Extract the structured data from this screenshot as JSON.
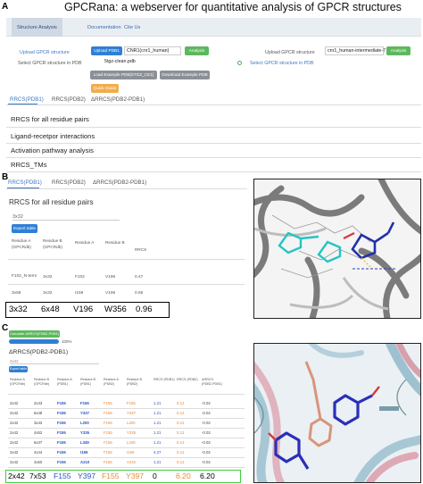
{
  "figure": {
    "title": "GPCRana: a webserver for quantitative analysis of GPCR structures",
    "panel_letters": [
      "A",
      "B",
      "C"
    ]
  },
  "panel_a": {
    "nav": [
      "Structure Analysis",
      "Documentation",
      "Cite Us"
    ],
    "upload_gpcr_label_left": "Upload GPCR structure",
    "select_pdb_label": "Select GPCR structure in PDB",
    "upload_pdb1_button": "Upload PDB1",
    "pdb1_value": "CNR1(cnr1_human)",
    "analysis_button": "Analysis",
    "pdb_file_value": "5tgz-clean.pdb",
    "load_example_pdb": "Load Example PDB(5TGZ_CE1)",
    "download_example_pdb": "Download Example PDB",
    "quick_guide_button": "Quick Guide",
    "upload_gpcr_label_right": "Upload GPCR structure",
    "right_select_value": "cnr1_human-intermediate-7",
    "select_pdb_right": "Select GPCR structure in PDB",
    "tabs": [
      "RRCS(PDB1)",
      "RRCS(PDB2)",
      "ΔRRCS(PDB2-PDB1)"
    ],
    "sections": [
      "RRCS for all residue pairs",
      "Ligand-recetpor interactions",
      "Activation pathway analysis",
      "RRCS_TMs"
    ],
    "colors": {
      "accent": "#2f7fd6",
      "green": "#5cb85c",
      "orange": "#f0ad4e",
      "link": "#3d79c1"
    }
  },
  "panel_b": {
    "tabs": [
      "RRCS(PDB1)",
      "RRCS(PDB2)",
      "ΔRRCS(PDB2-PDB1)"
    ],
    "title": "RRCS for all residue pairs",
    "input_value": "3x32",
    "export_button": "Export table",
    "headers": [
      "Residue A (GPCRdb)",
      "Residue B (GPCRdb)",
      "Residue A",
      "Residue B",
      "RRCS"
    ],
    "rows": [
      [
        "F102_N-term",
        "3x32",
        "F102",
        "V196",
        "0.47"
      ],
      [
        "3x56",
        "3x32",
        "I159",
        "V196",
        "0.55"
      ]
    ],
    "highlight_row": [
      "3x32",
      "6x48",
      "V196",
      "W356",
      "0.96"
    ]
  },
  "panel_c": {
    "calc_button": "Calculate ΔRRCS(PDB2-PDB1)",
    "progress_label": "100%",
    "progress_fraction": 1.0,
    "title": "ΔRRCS(PDB2-PDB1)",
    "input_value": "2x42",
    "export_button": "Export table",
    "headers": [
      "Residue A (GPCRdb)",
      "Residue B (GPCRdb)",
      "Residue A (PDB1)",
      "Residue B (PDB1)",
      "Residue A (PDB2)",
      "Residue B (PDB2)",
      "RRCS (PDB1)",
      "RRCS (PDB2)",
      "ΔRRCS (PDB2-PDB1)"
    ],
    "rows": [
      [
        "2x42",
        "2x43",
        "F155",
        "F155",
        "F155",
        "F155",
        "1.21",
        "0.12",
        "-0.02"
      ],
      [
        "2x42",
        "6x48",
        "F155",
        "Y337",
        "F155",
        "Y337",
        "1.21",
        "0.12",
        "-0.02"
      ],
      [
        "2x42",
        "3x43",
        "F155",
        "L200",
        "F155",
        "L200",
        "1.21",
        "0.12",
        "-0.02"
      ],
      [
        "2x42",
        "4x52",
        "F155",
        "Y335",
        "F155",
        "Y335",
        "1.21",
        "0.12",
        "-0.02"
      ],
      [
        "2x42",
        "6x37",
        "F155",
        "L349",
        "F155",
        "L349",
        "1.21",
        "0.12",
        "-0.02"
      ],
      [
        "2x42",
        "4x44",
        "F155",
        "I169",
        "F155",
        "I169",
        "4.27",
        "0.12",
        "-0.02"
      ],
      [
        "2x42",
        "4x50",
        "F155",
        "A210",
        "F155",
        "A210",
        "1.21",
        "0.12",
        "-0.02"
      ]
    ],
    "highlight_row": [
      "2x42",
      "7x53",
      "F155",
      "Y397",
      "F155",
      "Y397",
      "0",
      "6.20",
      "6.20"
    ],
    "colors": {
      "pdb1": "#2a52be",
      "pdb2": "#e8873a",
      "rrcs1": "#2a52be",
      "rrcs2": "#e8873a"
    }
  }
}
